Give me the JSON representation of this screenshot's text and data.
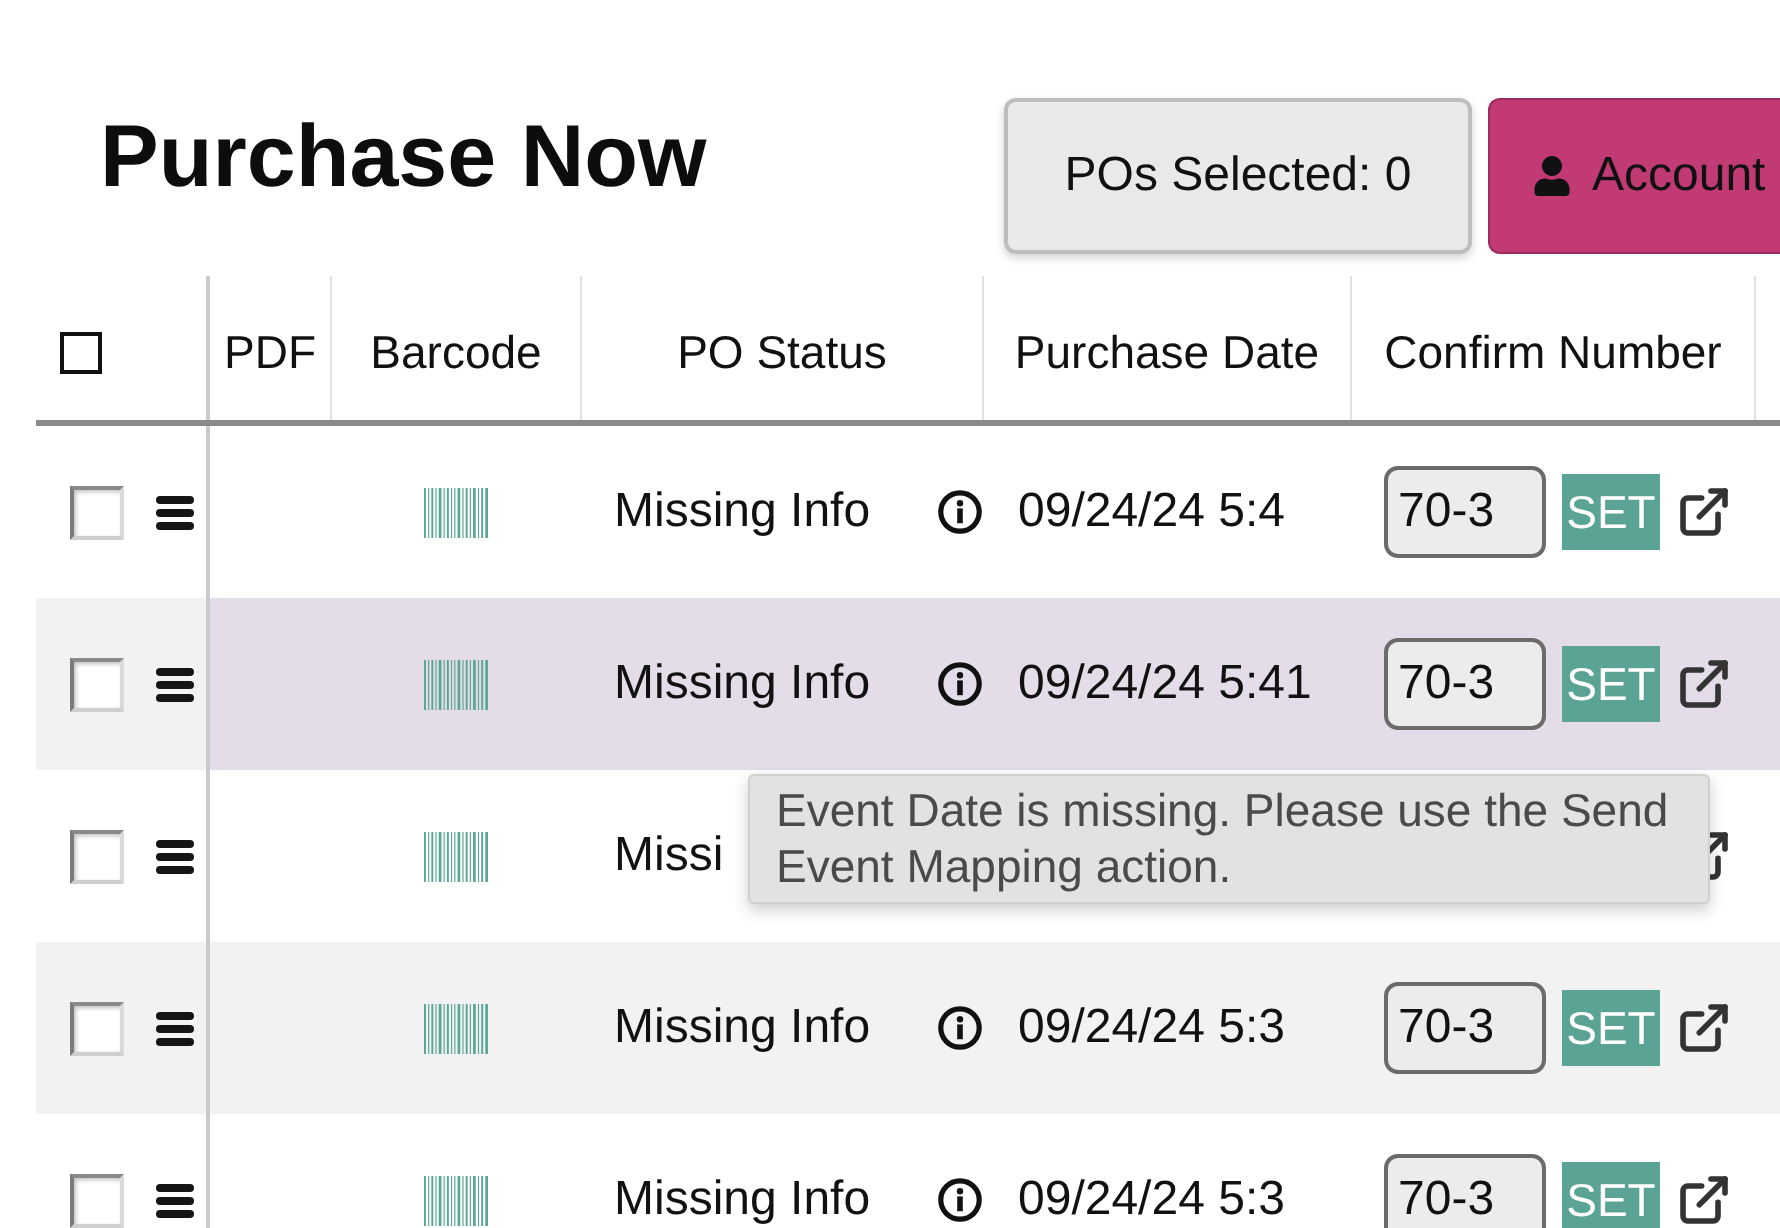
{
  "title": "Purchase Now",
  "toolbar": {
    "selected_counter": {
      "label": "POs Selected:",
      "count": "0"
    },
    "account_button": {
      "label": "Account"
    }
  },
  "table": {
    "select_all": {
      "checked": false
    },
    "columns": [
      "PDF",
      "Barcode",
      "PO Status",
      "Purchase Date",
      "Confirm Number"
    ],
    "rows": [
      {
        "checked": false,
        "highlighted": false,
        "status": "Missing Info",
        "date": "09/24/24 5:4",
        "confirm_number": "70-3",
        "action": "SET"
      },
      {
        "checked": false,
        "highlighted": true,
        "status": "Missing Info",
        "date": "09/24/24 5:41",
        "confirm_number": "70-3",
        "action": "SET"
      },
      {
        "checked": false,
        "highlighted": false,
        "status": "Missi"
      },
      {
        "checked": false,
        "highlighted": false,
        "status": "Missing Info",
        "date": "09/24/24 5:3",
        "confirm_number": "70-3",
        "action": "SET"
      },
      {
        "checked": false,
        "highlighted": false,
        "status": "Missing Info",
        "date": "09/24/24 5:3",
        "confirm_number": "70-3",
        "action": "SET"
      }
    ]
  },
  "tooltip": {
    "text": "Event Date is missing. Please use the Send Event Mapping action."
  }
}
